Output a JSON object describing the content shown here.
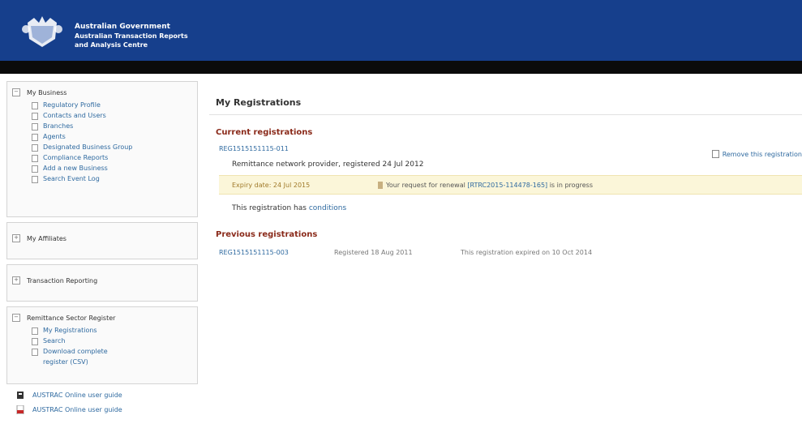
{
  "header": {
    "gov_title": "Australian Government",
    "agency_line1": "Australian Transaction Reports",
    "agency_line2": "and Analysis Centre"
  },
  "sidebar": {
    "my_business": {
      "title": "My Business",
      "items": [
        "Regulatory Profile",
        "Contacts and Users",
        "Branches",
        "Agents",
        "Designated Business Group",
        "Compliance Reports",
        "Add a new Business",
        "Search Event Log"
      ]
    },
    "my_affiliates": {
      "title": "My Affiliates"
    },
    "transaction_reporting": {
      "title": "Transaction Reporting"
    },
    "remittance_register": {
      "title": "Remittance Sector Register",
      "items": [
        "My Registrations",
        "Search",
        "Download complete register (CSV)"
      ]
    },
    "guides": [
      {
        "label": "AUSTRAC Online user guide",
        "icon": "book-icon"
      },
      {
        "label": "AUSTRAC Online user guide",
        "icon": "pdf-icon"
      }
    ]
  },
  "main": {
    "title": "My Registrations",
    "current": {
      "heading": "Current registrations",
      "reg_number": "REG1515151115-011",
      "remove_label": "Remove this registration",
      "detail": "Remittance network provider, registered 24 Jul 2012",
      "expiry": "Expiry date: 24 Jul 2015",
      "renewal_prefix": "Your request for renewal",
      "renewal_ref": "[RTRC2015-114478-165]",
      "renewal_suffix": "is in progress",
      "conditions_prefix": "This registration has",
      "conditions_link": "conditions"
    },
    "previous": {
      "heading": "Previous registrations",
      "rows": [
        {
          "reg_number": "REG1515151115-003",
          "registered": "Registered 18 Aug 2011",
          "status": "This registration expired on 10 Oct 2014"
        }
      ]
    }
  },
  "colors": {
    "header_blue": "#163f8c",
    "link_blue": "#2f6aa0",
    "section_red": "#8a2a1a",
    "notice_bg": "#fbf6d9"
  }
}
